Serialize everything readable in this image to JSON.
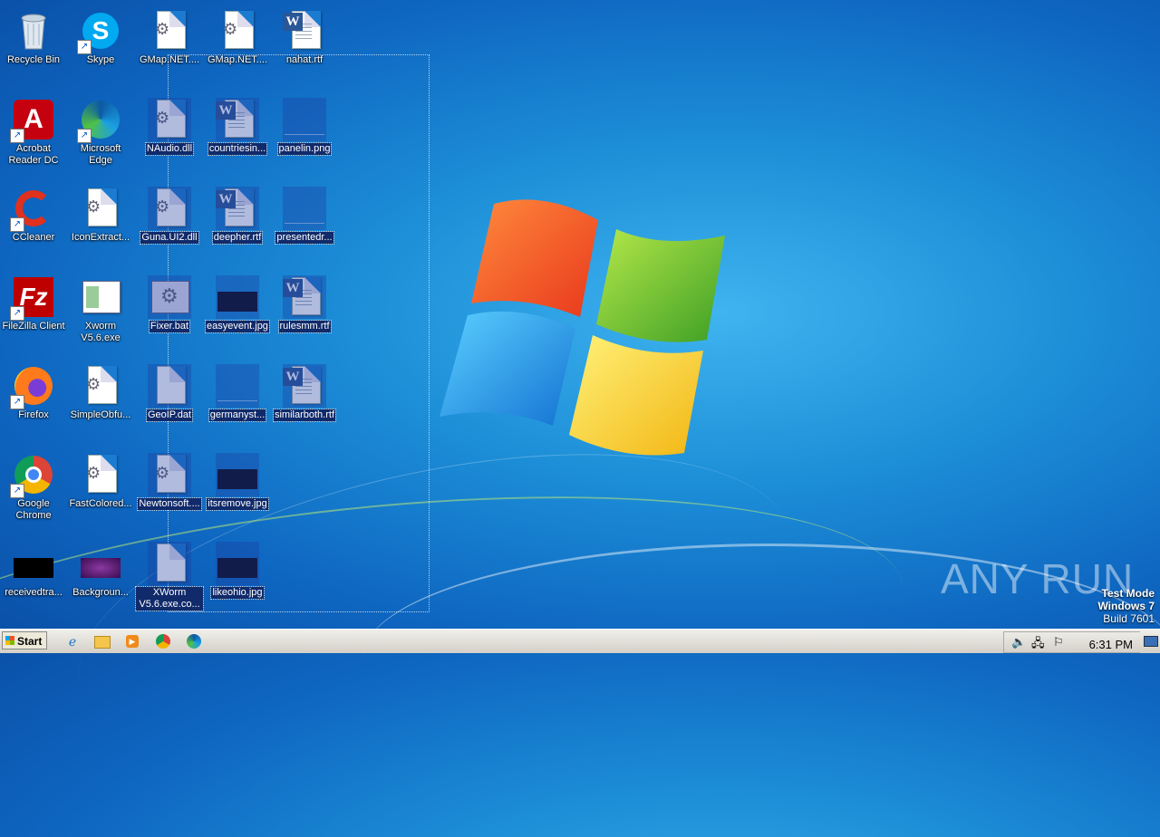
{
  "desktop": {
    "icons": [
      {
        "label": "Recycle Bin",
        "icon": "recycle-bin-icon"
      },
      {
        "label": "Skype",
        "icon": "skype-icon"
      },
      {
        "label": "GMap.NET....",
        "icon": "config-file-icon"
      },
      {
        "label": "GMap.NET....",
        "icon": "config-file-icon"
      },
      {
        "label": "nahat.rtf",
        "icon": "word-document-icon"
      },
      {
        "label": "Acrobat Reader DC",
        "icon": "acrobat-icon"
      },
      {
        "label": "Microsoft Edge",
        "icon": "edge-icon"
      },
      {
        "label": "NAudio.dll",
        "icon": "dll-file-icon"
      },
      {
        "label": "countriesin...",
        "icon": "word-document-icon"
      },
      {
        "label": "panelin.png",
        "icon": "image-file-icon"
      },
      {
        "label": "CCleaner",
        "icon": "ccleaner-icon"
      },
      {
        "label": "IconExtract...",
        "icon": "config-file-icon"
      },
      {
        "label": "Guna.UI2.dll",
        "icon": "dll-file-icon"
      },
      {
        "label": "deepher.rtf",
        "icon": "word-document-icon"
      },
      {
        "label": "presentedr...",
        "icon": "image-file-icon"
      },
      {
        "label": "FileZilla Client",
        "icon": "filezilla-icon"
      },
      {
        "label": "Xworm V5.6.exe",
        "icon": "application-window-icon"
      },
      {
        "label": "Fixer.bat",
        "icon": "batch-file-icon"
      },
      {
        "label": "easyevent.jpg",
        "icon": "image-file-icon"
      },
      {
        "label": "rulesmm.rtf",
        "icon": "word-document-icon"
      },
      {
        "label": "Firefox",
        "icon": "firefox-icon"
      },
      {
        "label": "SimpleObfu...",
        "icon": "config-file-icon"
      },
      {
        "label": "GeoIP.dat",
        "icon": "blank-file-icon"
      },
      {
        "label": "germanyst...",
        "icon": "image-file-icon"
      },
      {
        "label": "similarboth.rtf",
        "icon": "word-document-icon"
      },
      {
        "label": "Google Chrome",
        "icon": "chrome-icon"
      },
      {
        "label": "FastColored...",
        "icon": "config-file-icon"
      },
      {
        "label": "Newtonsoft....",
        "icon": "dll-file-icon"
      },
      {
        "label": "itsremove.jpg",
        "icon": "image-file-icon"
      },
      {
        "label": "receivedtra...",
        "icon": "image-file-icon"
      },
      {
        "label": "Backgroun...",
        "icon": "image-file-icon"
      },
      {
        "label": "XWorm V5.6.exe.co...",
        "icon": "blank-file-icon"
      },
      {
        "label": "likeohio.jpg",
        "icon": "image-file-icon"
      }
    ]
  },
  "watermark": "ANY RUN",
  "system_overlay": {
    "line1": "Test Mode",
    "line2": "Windows 7",
    "line3": "Build 7601"
  },
  "taskbar": {
    "start_label": "Start",
    "pinned": [
      "internet-explorer-icon",
      "explorer-folder-icon",
      "media-player-icon",
      "chrome-icon",
      "edge-icon"
    ],
    "tray_icons": [
      "volume-icon",
      "network-icon",
      "action-center-flag-icon"
    ],
    "clock": "6:31 PM"
  }
}
